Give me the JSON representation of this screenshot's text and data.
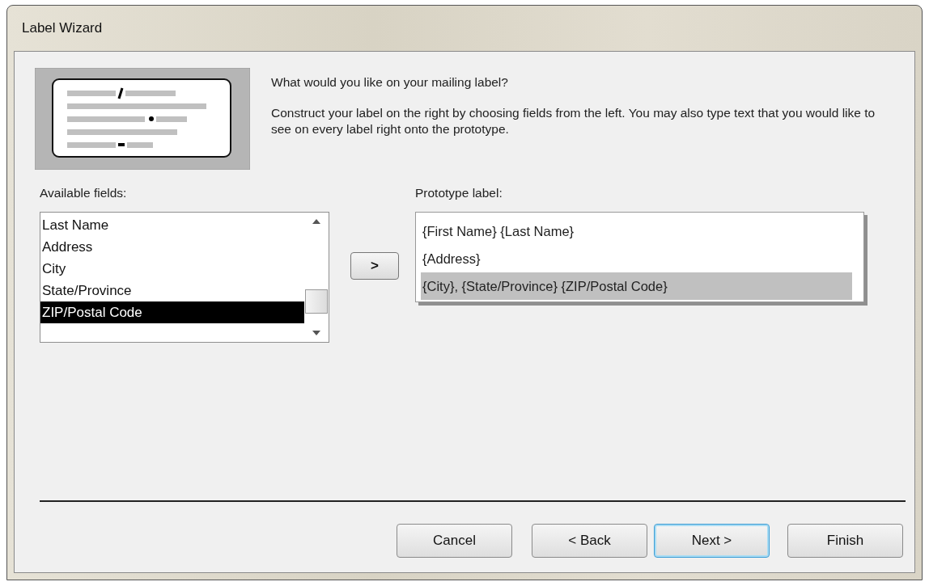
{
  "window": {
    "title": "Label Wizard"
  },
  "prompt": "What would you like on your mailing label?",
  "instructions": "Construct your label on the right by choosing fields from the left. You may also type text that you would like to see on every label right onto the prototype.",
  "available_fields": {
    "label": "Available fields:",
    "items": [
      {
        "text": "Last Name",
        "selected": false
      },
      {
        "text": "Address",
        "selected": false
      },
      {
        "text": "City",
        "selected": false
      },
      {
        "text": "State/Province",
        "selected": false
      },
      {
        "text": "ZIP/Postal Code",
        "selected": true
      }
    ]
  },
  "add_button": ">",
  "prototype": {
    "label": "Prototype label:",
    "lines": [
      {
        "text": "{First Name} {Last Name}",
        "selected": false
      },
      {
        "text": "{Address}",
        "selected": false
      },
      {
        "text": "{City}, {State/Province} {ZIP/Postal Code}",
        "selected": true
      }
    ]
  },
  "buttons": [
    {
      "label": "Cancel",
      "default": false
    },
    {
      "label": "< Back",
      "default": false
    },
    {
      "label": "Next >",
      "default": true
    },
    {
      "label": "Finish",
      "default": false
    }
  ]
}
